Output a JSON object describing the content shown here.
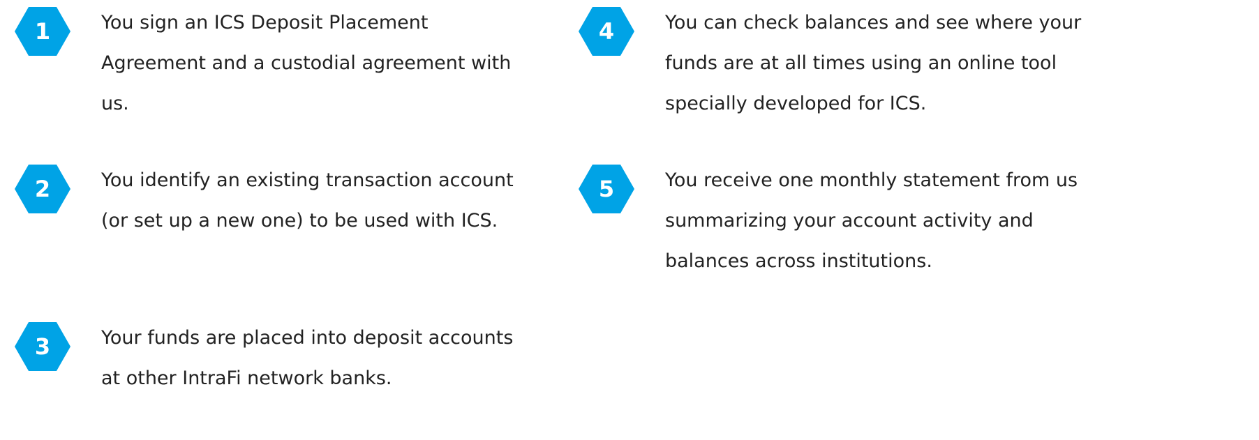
{
  "brand": {
    "badge_color": "#00a3e6",
    "text_color": "#222222"
  },
  "steps": [
    {
      "number": "1",
      "text": "You sign an ICS Deposit Placement Agreement and a custodial agreement with us."
    },
    {
      "number": "2",
      "text": "You identify an existing transaction account (or set up a new one) to be used with ICS."
    },
    {
      "number": "3",
      "text": "Your funds are placed into deposit accounts at other IntraFi network banks."
    },
    {
      "number": "4",
      "text": "You can check balances and see where your funds are at all times using an online tool specially developed for ICS."
    },
    {
      "number": "5",
      "text": "You receive one monthly statement from us summarizing your account activity and balances across institutions."
    }
  ]
}
